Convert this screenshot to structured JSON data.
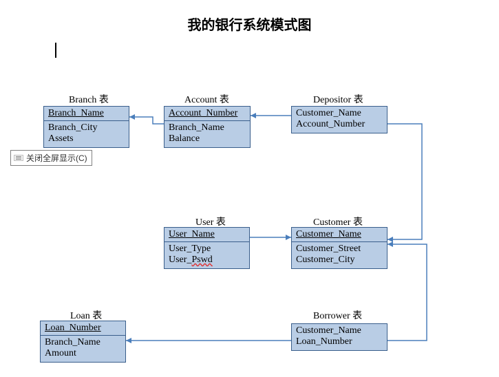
{
  "title": "我的银行系统模式图",
  "tooltip": {
    "label": "关闭全屏显示(C)"
  },
  "tables": {
    "branch": {
      "label": "Branch 表",
      "pk": "Branch_Name",
      "cols": [
        "Branch_City",
        "Assets"
      ]
    },
    "account": {
      "label": "Account 表",
      "pk": "Account_Number",
      "cols": [
        "Branch_Name",
        "Balance"
      ]
    },
    "depositor": {
      "label": "Depositor 表",
      "cols": [
        "Customer_Name",
        "Account_Number"
      ]
    },
    "user": {
      "label": "User 表",
      "pk": "User_Name",
      "cols": [
        "User_Type",
        "User_Pswd"
      ]
    },
    "customer": {
      "label": "Customer 表",
      "pk": "Customer_Name",
      "cols": [
        "Customer_Street",
        "Customer_City"
      ]
    },
    "loan": {
      "label": "Loan 表",
      "pk": "Loan_Number",
      "cols": [
        "Branch_Name",
        "Amount"
      ]
    },
    "borrower": {
      "label": "Borrower 表",
      "cols": [
        "Customer_Name",
        "Loan_Number"
      ]
    }
  }
}
